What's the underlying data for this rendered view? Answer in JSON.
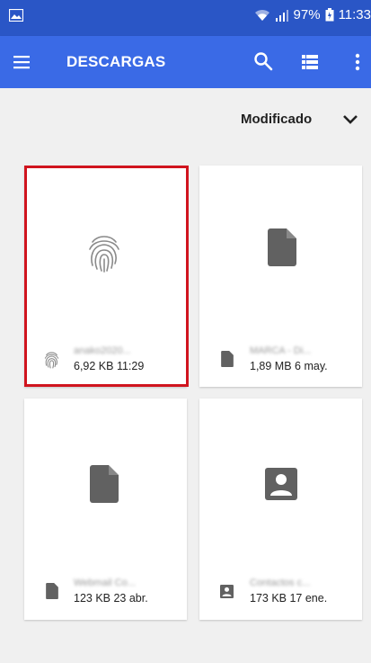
{
  "status_bar": {
    "battery_text": "97%",
    "time": "11:33"
  },
  "app_bar": {
    "title": "DESCARGAS",
    "icons": [
      "menu-icon",
      "search-icon",
      "list-view-icon",
      "more-vert-icon"
    ]
  },
  "sort": {
    "label": "Modificado"
  },
  "files": [
    {
      "name": "anako2020...",
      "meta": "6,92 KB 11:29",
      "type": "fingerprint",
      "selected": true
    },
    {
      "name": "MARCA - Di...",
      "meta": "1,89 MB 6 may.",
      "type": "document",
      "selected": false
    },
    {
      "name": "Webmail Co...",
      "meta": "123 KB 23 abr.",
      "type": "document",
      "selected": false
    },
    {
      "name": "Contactos c...",
      "meta": "173 KB 17 ene.",
      "type": "contact",
      "selected": false
    }
  ],
  "colors": {
    "status_bar": "#2a56c6",
    "app_bar": "#3a6ae6",
    "background": "#f0f0f0",
    "selection": "#d0141e",
    "icon_gray": "#616161"
  }
}
